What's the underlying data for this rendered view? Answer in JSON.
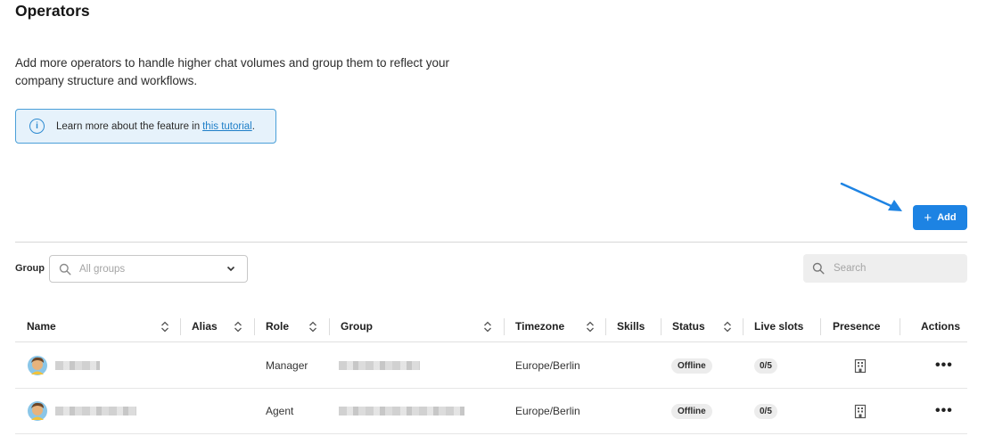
{
  "page": {
    "title": "Operators",
    "description": "Add more operators to handle higher chat volumes and group them to reflect your company structure and workflows."
  },
  "info_box": {
    "text": "Learn more about the feature in ",
    "link_text": "this tutorial",
    "suffix": "."
  },
  "toolbar": {
    "add_label": "Add",
    "group_label": "Group",
    "group_placeholder": "All groups",
    "search_placeholder": "Search"
  },
  "table": {
    "columns": {
      "name": "Name",
      "alias": "Alias",
      "role": "Role",
      "group": "Group",
      "timezone": "Timezone",
      "skills": "Skills",
      "status": "Status",
      "live_slots": "Live slots",
      "presence": "Presence",
      "actions": "Actions"
    },
    "rows": [
      {
        "role": "Manager",
        "timezone": "Europe/Berlin",
        "status": "Offline",
        "live_slots": "0/5"
      },
      {
        "role": "Agent",
        "timezone": "Europe/Berlin",
        "status": "Offline",
        "live_slots": "0/5"
      }
    ]
  },
  "colors": {
    "accent": "#1d83e3",
    "info_bg": "#e6f2fb",
    "info_border": "#4a9fd8"
  },
  "icons": [
    "info-icon",
    "arrow-icon",
    "plus-icon",
    "search-icon",
    "chevron-down-icon",
    "sort-icon",
    "avatar-icon",
    "building-icon",
    "more-icon"
  ]
}
